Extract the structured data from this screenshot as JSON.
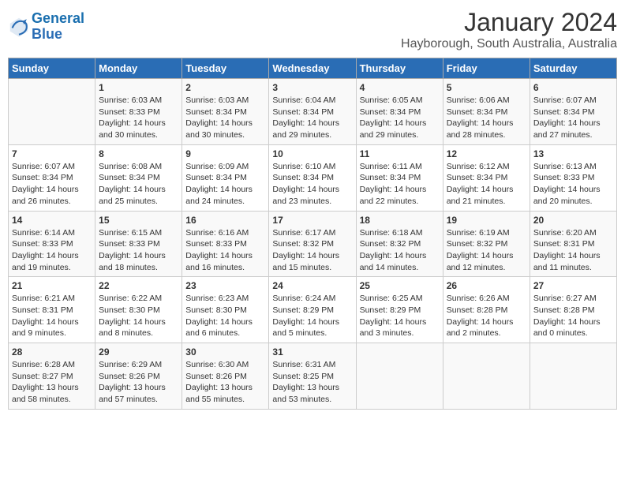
{
  "header": {
    "logo_line1": "General",
    "logo_line2": "Blue",
    "month_year": "January 2024",
    "location": "Hayborough, South Australia, Australia"
  },
  "weekdays": [
    "Sunday",
    "Monday",
    "Tuesday",
    "Wednesday",
    "Thursday",
    "Friday",
    "Saturday"
  ],
  "weeks": [
    [
      {
        "day": "",
        "text": ""
      },
      {
        "day": "1",
        "text": "Sunrise: 6:03 AM\nSunset: 8:33 PM\nDaylight: 14 hours\nand 30 minutes."
      },
      {
        "day": "2",
        "text": "Sunrise: 6:03 AM\nSunset: 8:34 PM\nDaylight: 14 hours\nand 30 minutes."
      },
      {
        "day": "3",
        "text": "Sunrise: 6:04 AM\nSunset: 8:34 PM\nDaylight: 14 hours\nand 29 minutes."
      },
      {
        "day": "4",
        "text": "Sunrise: 6:05 AM\nSunset: 8:34 PM\nDaylight: 14 hours\nand 29 minutes."
      },
      {
        "day": "5",
        "text": "Sunrise: 6:06 AM\nSunset: 8:34 PM\nDaylight: 14 hours\nand 28 minutes."
      },
      {
        "day": "6",
        "text": "Sunrise: 6:07 AM\nSunset: 8:34 PM\nDaylight: 14 hours\nand 27 minutes."
      }
    ],
    [
      {
        "day": "7",
        "text": "Sunrise: 6:07 AM\nSunset: 8:34 PM\nDaylight: 14 hours\nand 26 minutes."
      },
      {
        "day": "8",
        "text": "Sunrise: 6:08 AM\nSunset: 8:34 PM\nDaylight: 14 hours\nand 25 minutes."
      },
      {
        "day": "9",
        "text": "Sunrise: 6:09 AM\nSunset: 8:34 PM\nDaylight: 14 hours\nand 24 minutes."
      },
      {
        "day": "10",
        "text": "Sunrise: 6:10 AM\nSunset: 8:34 PM\nDaylight: 14 hours\nand 23 minutes."
      },
      {
        "day": "11",
        "text": "Sunrise: 6:11 AM\nSunset: 8:34 PM\nDaylight: 14 hours\nand 22 minutes."
      },
      {
        "day": "12",
        "text": "Sunrise: 6:12 AM\nSunset: 8:34 PM\nDaylight: 14 hours\nand 21 minutes."
      },
      {
        "day": "13",
        "text": "Sunrise: 6:13 AM\nSunset: 8:33 PM\nDaylight: 14 hours\nand 20 minutes."
      }
    ],
    [
      {
        "day": "14",
        "text": "Sunrise: 6:14 AM\nSunset: 8:33 PM\nDaylight: 14 hours\nand 19 minutes."
      },
      {
        "day": "15",
        "text": "Sunrise: 6:15 AM\nSunset: 8:33 PM\nDaylight: 14 hours\nand 18 minutes."
      },
      {
        "day": "16",
        "text": "Sunrise: 6:16 AM\nSunset: 8:33 PM\nDaylight: 14 hours\nand 16 minutes."
      },
      {
        "day": "17",
        "text": "Sunrise: 6:17 AM\nSunset: 8:32 PM\nDaylight: 14 hours\nand 15 minutes."
      },
      {
        "day": "18",
        "text": "Sunrise: 6:18 AM\nSunset: 8:32 PM\nDaylight: 14 hours\nand 14 minutes."
      },
      {
        "day": "19",
        "text": "Sunrise: 6:19 AM\nSunset: 8:32 PM\nDaylight: 14 hours\nand 12 minutes."
      },
      {
        "day": "20",
        "text": "Sunrise: 6:20 AM\nSunset: 8:31 PM\nDaylight: 14 hours\nand 11 minutes."
      }
    ],
    [
      {
        "day": "21",
        "text": "Sunrise: 6:21 AM\nSunset: 8:31 PM\nDaylight: 14 hours\nand 9 minutes."
      },
      {
        "day": "22",
        "text": "Sunrise: 6:22 AM\nSunset: 8:30 PM\nDaylight: 14 hours\nand 8 minutes."
      },
      {
        "day": "23",
        "text": "Sunrise: 6:23 AM\nSunset: 8:30 PM\nDaylight: 14 hours\nand 6 minutes."
      },
      {
        "day": "24",
        "text": "Sunrise: 6:24 AM\nSunset: 8:29 PM\nDaylight: 14 hours\nand 5 minutes."
      },
      {
        "day": "25",
        "text": "Sunrise: 6:25 AM\nSunset: 8:29 PM\nDaylight: 14 hours\nand 3 minutes."
      },
      {
        "day": "26",
        "text": "Sunrise: 6:26 AM\nSunset: 8:28 PM\nDaylight: 14 hours\nand 2 minutes."
      },
      {
        "day": "27",
        "text": "Sunrise: 6:27 AM\nSunset: 8:28 PM\nDaylight: 14 hours\nand 0 minutes."
      }
    ],
    [
      {
        "day": "28",
        "text": "Sunrise: 6:28 AM\nSunset: 8:27 PM\nDaylight: 13 hours\nand 58 minutes."
      },
      {
        "day": "29",
        "text": "Sunrise: 6:29 AM\nSunset: 8:26 PM\nDaylight: 13 hours\nand 57 minutes."
      },
      {
        "day": "30",
        "text": "Sunrise: 6:30 AM\nSunset: 8:26 PM\nDaylight: 13 hours\nand 55 minutes."
      },
      {
        "day": "31",
        "text": "Sunrise: 6:31 AM\nSunset: 8:25 PM\nDaylight: 13 hours\nand 53 minutes."
      },
      {
        "day": "",
        "text": ""
      },
      {
        "day": "",
        "text": ""
      },
      {
        "day": "",
        "text": ""
      }
    ]
  ]
}
